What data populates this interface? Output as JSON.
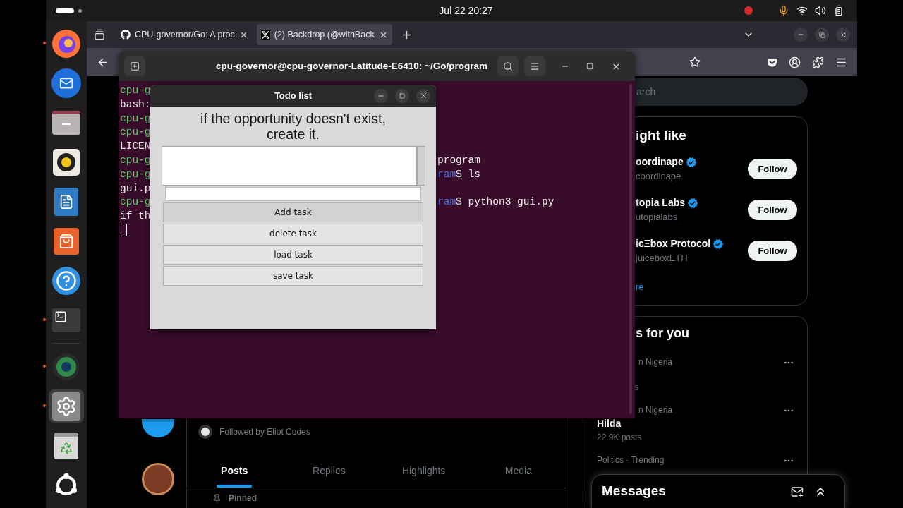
{
  "top_bar": {
    "clock": "Jul 22  20:27"
  },
  "dock": {
    "apps": [
      {
        "kind": "browser",
        "running": true,
        "selected": false
      },
      {
        "kind": "mail",
        "running": false,
        "selected": false
      },
      {
        "kind": "files",
        "running": false,
        "selected": false
      },
      {
        "kind": "music",
        "running": false,
        "selected": false
      },
      {
        "kind": "writer",
        "running": false,
        "selected": false
      },
      {
        "kind": "store",
        "running": false,
        "selected": false
      },
      {
        "kind": "help",
        "running": false,
        "selected": false
      },
      {
        "kind": "terminal",
        "running": true,
        "selected": false
      },
      {
        "kind": "camera",
        "running": true,
        "selected": false
      },
      {
        "kind": "settings",
        "running": true,
        "selected": true
      },
      {
        "kind": "trash",
        "running": false,
        "selected": false
      },
      {
        "kind": "apps",
        "running": false,
        "selected": false
      }
    ]
  },
  "browser": {
    "tabs": [
      {
        "title": "CPU-governor/Go: A proc",
        "kind": "github",
        "selected": false
      },
      {
        "title": "(2) Backdrop (@withBack",
        "kind": "x",
        "selected": true
      }
    ],
    "search": {
      "placeholder": "arch"
    },
    "who_to_follow": {
      "title": "ight like",
      "accounts": [
        {
          "name": "oordinape",
          "handle": "coordinape",
          "verified": true,
          "button": "Follow"
        },
        {
          "name": "topia Labs",
          "handle": "utopialabs_",
          "verified": true,
          "button": "Follow"
        },
        {
          "name": "icΞbox Protocol",
          "handle": "juiceboxETH",
          "verified": true,
          "button": "Follow"
        }
      ],
      "show_more": "re"
    },
    "trends": {
      "title": "s for you",
      "items": [
        {
          "context": "n Nigeria",
          "posts": "s"
        },
        {
          "context": "n Nigeria",
          "name": "Hilda",
          "posts": "22.9K posts"
        },
        {
          "context": "Politics · Trending"
        }
      ]
    },
    "profile": {
      "followed_by": "Followed by Eliot Codes",
      "tabs": [
        {
          "label": "Posts",
          "selected": true
        },
        {
          "label": "Replies",
          "selected": false
        },
        {
          "label": "Highlights",
          "selected": false
        },
        {
          "label": "Media",
          "selected": false
        }
      ],
      "pinned": "Pinned"
    },
    "messages": {
      "title": "Messages"
    }
  },
  "terminal": {
    "title": "cpu-governor@cpu-governor-Latitude-E6410: ~/Go/program",
    "lines": [
      {
        "left": [
          {
            "kind": "prompt",
            "text": "cpu-g"
          }
        ]
      },
      {
        "left": [
          {
            "kind": "plain",
            "text": "bash:"
          }
        ]
      },
      {
        "left": [
          {
            "kind": "prompt",
            "text": "cpu-g"
          }
        ]
      },
      {
        "left": [
          {
            "kind": "prompt",
            "text": "cpu-g"
          }
        ]
      },
      {
        "left": [
          {
            "kind": "plain",
            "text": "LICEN"
          }
        ]
      },
      {
        "left": [
          {
            "kind": "prompt",
            "text": "cpu-g"
          }
        ],
        "right": [
          {
            "kind": "plain",
            "text": "program"
          }
        ]
      },
      {
        "left": [
          {
            "kind": "prompt",
            "text": "cpu-g"
          }
        ],
        "right": [
          {
            "kind": "path",
            "text": "ram"
          },
          {
            "kind": "plain",
            "text": "$ ls"
          }
        ]
      },
      {
        "left": [
          {
            "kind": "plain",
            "text": "gui.p"
          }
        ]
      },
      {
        "left": [
          {
            "kind": "prompt",
            "text": "cpu-g"
          }
        ],
        "right": [
          {
            "kind": "path",
            "text": "ram"
          },
          {
            "kind": "plain",
            "text": "$ python3 gui.py"
          }
        ]
      },
      {
        "left": [
          {
            "kind": "plain",
            "text": "if th"
          }
        ]
      }
    ]
  },
  "todo_window": {
    "title": "Todo list",
    "quote": [
      "if the opportunity doesn't exist,",
      "create it."
    ],
    "buttons": [
      {
        "label": "Add task",
        "hovered": true
      },
      {
        "label": "delete task",
        "hovered": false
      },
      {
        "label": "load task",
        "hovered": false
      },
      {
        "label": "save task",
        "hovered": false
      }
    ]
  }
}
